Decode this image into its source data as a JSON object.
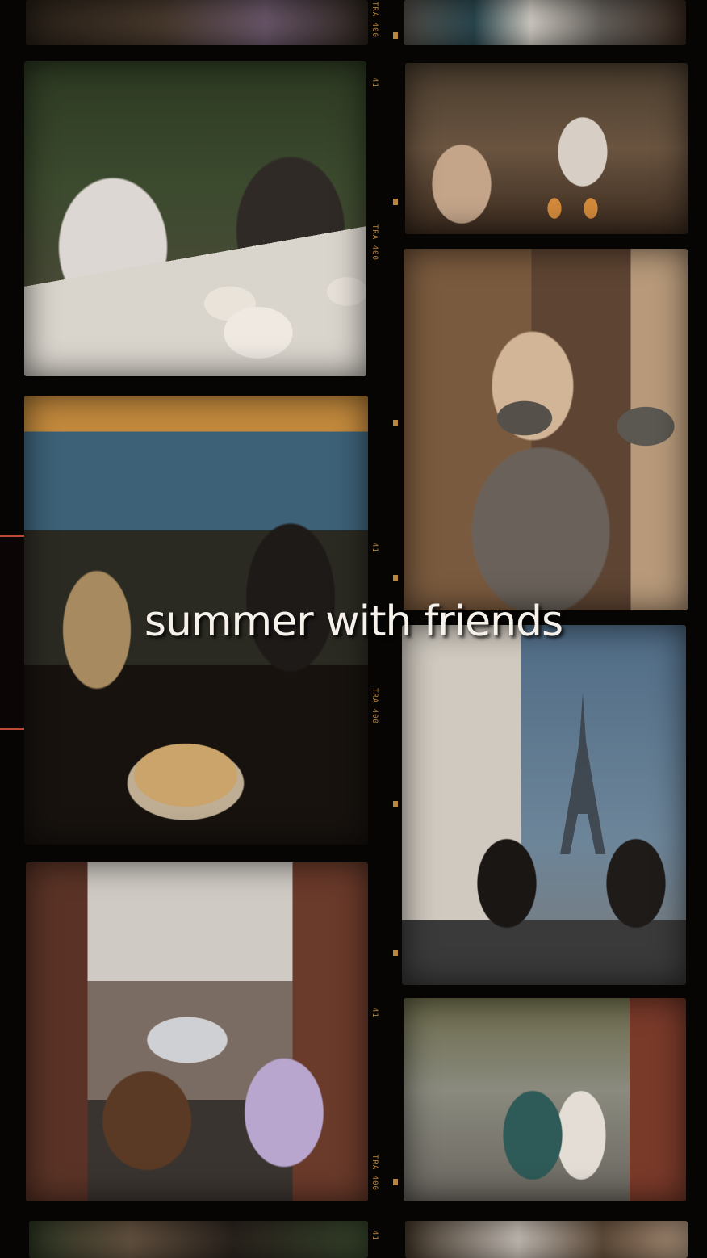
{
  "caption": "summer with friends",
  "film_codes": [
    "TRA 400",
    "41",
    "TRA 400",
    "41",
    "TRA 400",
    "41",
    "TRA 400",
    "41"
  ],
  "photos": [
    {
      "name": "photo-top-left-strip",
      "tone": "#3a2e25"
    },
    {
      "name": "photo-top-right-strip",
      "tone": "#3b3126"
    },
    {
      "name": "photo-cafe-reading",
      "tone": "#4a3e32"
    },
    {
      "name": "photo-cafe-drinks",
      "tone": "#5a4533"
    },
    {
      "name": "photo-cocoa-cups",
      "tone": "#5b4636"
    },
    {
      "name": "photo-fries-dinner",
      "tone": "#3f3022"
    },
    {
      "name": "photo-eiffel-tower",
      "tone": "#46596a"
    },
    {
      "name": "photo-snow-street",
      "tone": "#4e4640"
    },
    {
      "name": "photo-walking-street",
      "tone": "#4a4a3f"
    },
    {
      "name": "photo-bottom-left-strip",
      "tone": "#3e3328"
    },
    {
      "name": "photo-bottom-right-strip",
      "tone": "#4a3a2c"
    }
  ]
}
